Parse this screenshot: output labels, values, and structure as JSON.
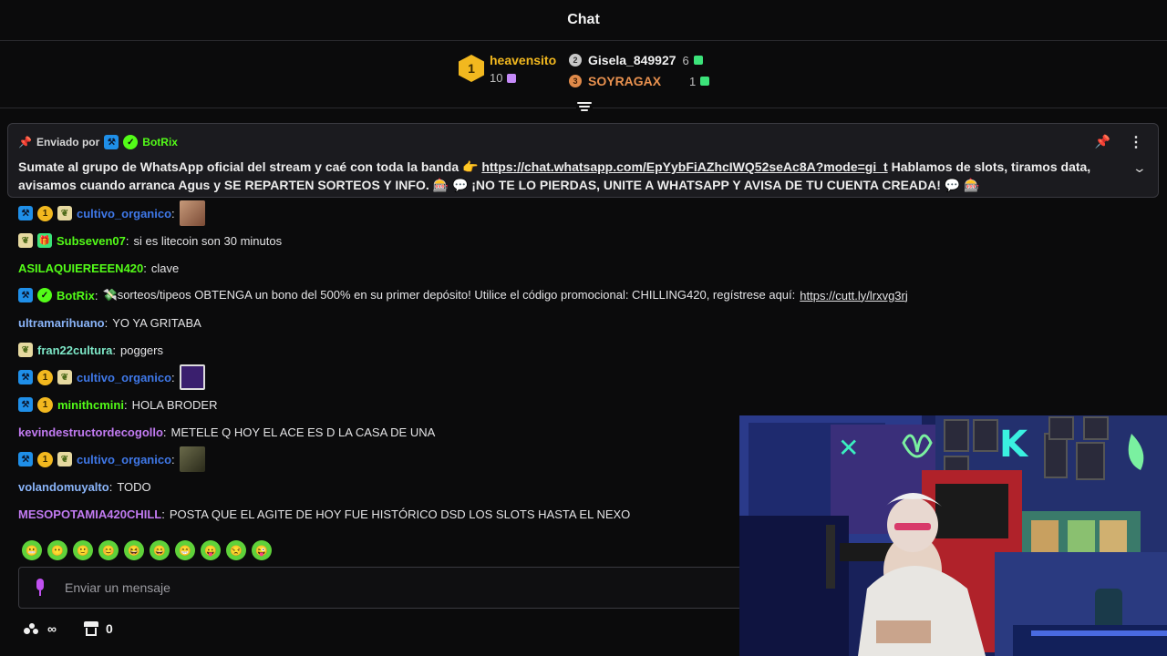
{
  "header": {
    "title": "Chat"
  },
  "leaderboard": {
    "first": {
      "rank": "1",
      "name": "heavensito",
      "count": "10"
    },
    "second": {
      "rank": "2",
      "name": "Gisela_849927",
      "count": "6"
    },
    "third": {
      "rank": "3",
      "name": "SOYRAGAX",
      "count": "1"
    }
  },
  "pinned": {
    "sent_by_label": "Enviado por",
    "sender": "BotRix",
    "text_before": "Sumate al grupo de WhatsApp oficial del stream y caé con toda la banda 👉",
    "link": "https://chat.whatsapp.com/EpYybFiAZhcIWQ52seAc8A?mode=gi_t",
    "text_after": "Hablamos de slots, tiramos data, avisamos cuando arranca Agus y SE REPARTEN SORTEOS Y INFO. 🎰 💬 ¡NO TE LO PIERDAS, UNITE A WHATSAPP Y AVISA DE TU CUENTA CREADA! 💬 🎰"
  },
  "messages": [
    {
      "user": "cultivo_organico",
      "text": "",
      "color": "#3f78e8"
    },
    {
      "user": "Subseven07",
      "text": "si es litecoin son 30 minutos",
      "color": "#53fc18"
    },
    {
      "user": "ASILAQUIEREEEN420",
      "text": "clave",
      "color": "#53fc18"
    },
    {
      "user": "BotRix",
      "text": "💸sorteos/tipeos OBTENGA un bono del 500% en su primer depósito! Utilice el código promocional: CHILLING420, regístrese aquí:",
      "link": "https://cutt.ly/lrxvg3rj",
      "color": "#53fc18"
    },
    {
      "user": "ultramarihuano",
      "text": "YO YA GRITABA",
      "color": "#8ab4f8"
    },
    {
      "user": "fran22cultura",
      "text": "poggers",
      "color": "#7ee8c8"
    },
    {
      "user": "cultivo_organico",
      "text": "",
      "color": "#3f78e8"
    },
    {
      "user": "minithcmini",
      "text": "HOLA BRODER",
      "color": "#53fc18"
    },
    {
      "user": "kevindestructordecogollo",
      "text": "METELE Q HOY EL ACE ES D LA CASA DE UNA",
      "color": "#c27bf2"
    },
    {
      "user": "cultivo_organico",
      "text": "",
      "color": "#3f78e8"
    },
    {
      "user": "volandomuyalto",
      "text": "TODO",
      "color": "#8ab4f8"
    },
    {
      "user": "MESOPOTAMIA420CHILL",
      "text": "POSTA QUE EL AGITE DE HOY FUE HISTÓRICO DSD LOS SLOTS HASTA EL NEXO",
      "color": "#c27bf2"
    }
  ],
  "badges": {
    "sub_months": "1"
  },
  "input": {
    "placeholder": "Enviar un mensaje"
  },
  "footer": {
    "points": "∞",
    "store_count": "0"
  },
  "emotes": [
    "😬",
    "😶",
    "🙂",
    "😊",
    "😆",
    "😄",
    "😁",
    "😛",
    "😒",
    "😜"
  ]
}
